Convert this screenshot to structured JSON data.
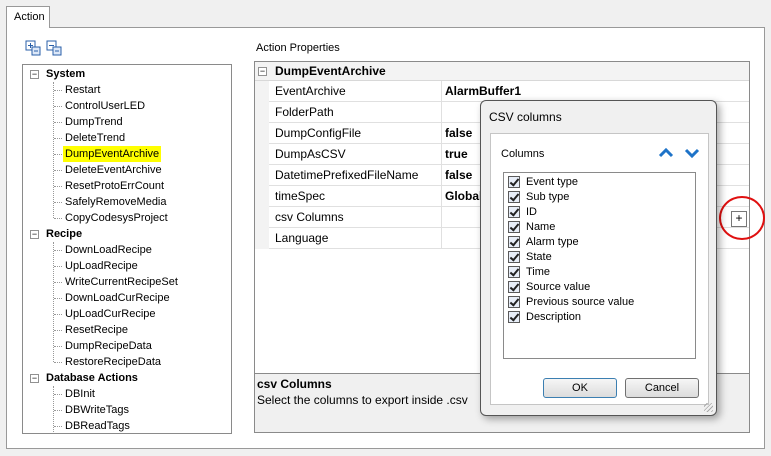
{
  "tab": {
    "label": "Action"
  },
  "toolbar": {
    "icons": [
      "expand-all-icon",
      "collapse-all-icon"
    ]
  },
  "tree": {
    "groups": [
      {
        "label": "System",
        "items": [
          "Restart",
          "ControlUserLED",
          "DumpTrend",
          "DeleteTrend",
          "DumpEventArchive",
          "DeleteEventArchive",
          "ResetProtoErrCount",
          "SafelyRemoveMedia",
          "CopyCodesysProject"
        ]
      },
      {
        "label": "Recipe",
        "items": [
          "DownLoadRecipe",
          "UpLoadRecipe",
          "WriteCurrentRecipeSet",
          "DownLoadCurRecipe",
          "UpLoadCurRecipe",
          "ResetRecipe",
          "DumpRecipeData",
          "RestoreRecipeData"
        ]
      },
      {
        "label": "Database Actions",
        "items": [
          "DBInit",
          "DBWriteTags",
          "DBReadTags"
        ]
      }
    ],
    "selected": "DumpEventArchive",
    "toggle_symbol": "−"
  },
  "properties": {
    "label": "Action Properties",
    "header": "DumpEventArchive",
    "rows": [
      {
        "name": "EventArchive",
        "value": "AlarmBuffer1"
      },
      {
        "name": "FolderPath",
        "value": ""
      },
      {
        "name": "DumpConfigFile",
        "value": "false"
      },
      {
        "name": "DumpAsCSV",
        "value": "true"
      },
      {
        "name": "DatetimePrefixedFileName",
        "value": "false"
      },
      {
        "name": "timeSpec",
        "value": "Global"
      },
      {
        "name": "csv Columns",
        "value": ""
      },
      {
        "name": "Language",
        "value": ""
      }
    ],
    "description_title": "csv Columns",
    "description_text": "Select the columns to export inside .csv",
    "plus_label": "+",
    "highlight_color": "#e01010"
  },
  "dialog": {
    "title": "CSV columns",
    "columns_label": "Columns",
    "columns": [
      "Event type",
      "Sub type",
      "ID",
      "Name",
      "Alarm type",
      "State",
      "Time",
      "Source value",
      "Previous source value",
      "Description"
    ],
    "ok_label": "OK",
    "cancel_label": "Cancel",
    "arrow_color": "#1e73c8"
  }
}
